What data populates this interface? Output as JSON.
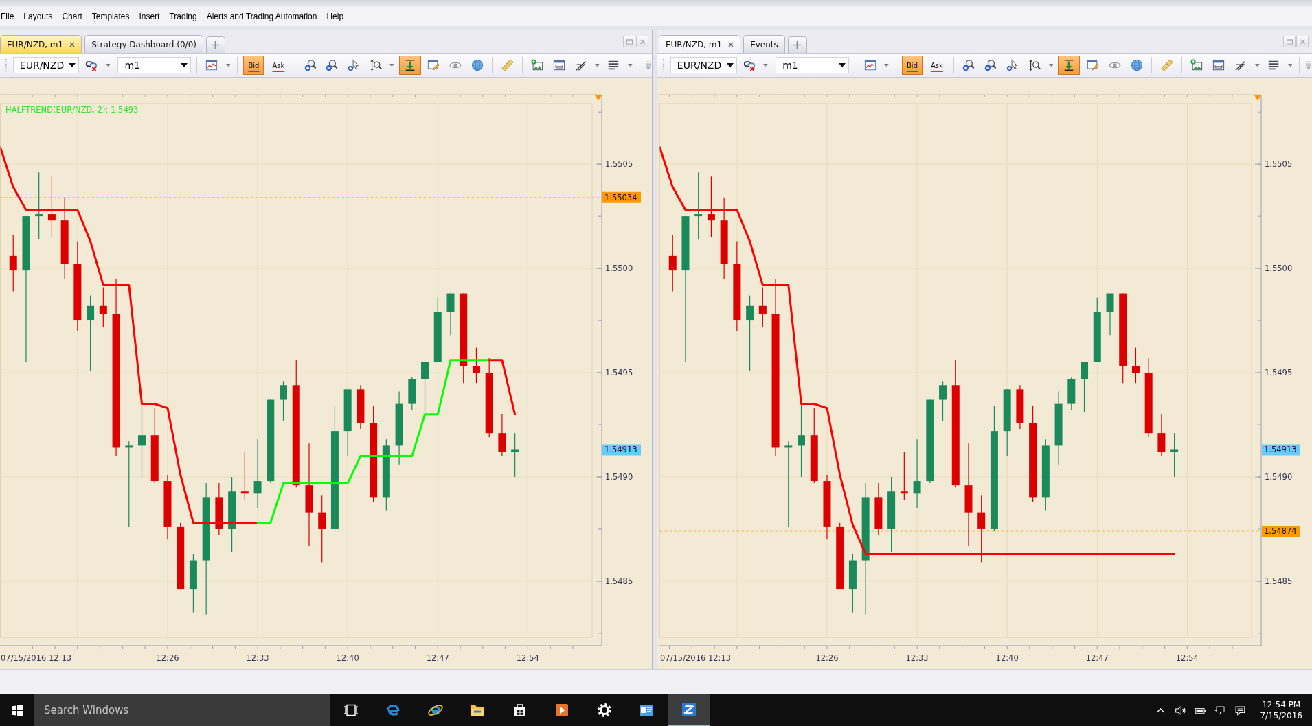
{
  "menu": [
    "File",
    "Layouts",
    "Chart",
    "Templates",
    "Insert",
    "Trading",
    "Alerts and Trading Automation",
    "Help"
  ],
  "panels": [
    {
      "active": true,
      "tabs": [
        {
          "label": "EUR/NZD, m1",
          "selected": true
        },
        {
          "label": "Strategy Dashboard (0/0)",
          "selected": false
        }
      ],
      "toolbar": {
        "symbol": "EUR/NZD",
        "timeframe": "m1",
        "price_modes": [
          {
            "label": "Bid",
            "selected": true
          },
          {
            "label": "Ask",
            "selected": false
          }
        ],
        "scroll_toggle": {
          "selected": true
        }
      },
      "chart_data": {
        "type": "candlestick",
        "x": [
          "2016-07-15T12:14",
          "2016-07-15T12:15",
          "2016-07-15T12:16",
          "2016-07-15T12:17",
          "2016-07-15T12:18",
          "2016-07-15T12:19",
          "2016-07-15T12:20",
          "2016-07-15T12:21",
          "2016-07-15T12:22",
          "2016-07-15T12:23",
          "2016-07-15T12:24",
          "2016-07-15T12:25",
          "2016-07-15T12:26",
          "2016-07-15T12:27",
          "2016-07-15T12:28",
          "2016-07-15T12:29",
          "2016-07-15T12:30",
          "2016-07-15T12:31",
          "2016-07-15T12:32",
          "2016-07-15T12:33",
          "2016-07-15T12:34",
          "2016-07-15T12:35",
          "2016-07-15T12:36",
          "2016-07-15T12:37",
          "2016-07-15T12:38",
          "2016-07-15T12:39",
          "2016-07-15T12:40",
          "2016-07-15T12:41",
          "2016-07-15T12:42",
          "2016-07-15T12:43",
          "2016-07-15T12:44",
          "2016-07-15T12:45",
          "2016-07-15T12:46",
          "2016-07-15T12:47",
          "2016-07-15T12:48",
          "2016-07-15T12:49",
          "2016-07-15T12:50",
          "2016-07-15T12:51",
          "2016-07-15T12:52",
          "2016-07-15T12:53"
        ],
        "ohlc": [
          [
            1.55006,
            1.55016,
            1.54989,
            1.54999
          ],
          [
            1.54999,
            1.55025,
            1.54955,
            1.55025
          ],
          [
            1.55025,
            1.55046,
            1.55014,
            1.55026
          ],
          [
            1.55026,
            1.55044,
            1.55015,
            1.55023
          ],
          [
            1.55023,
            1.55034,
            1.54995,
            1.55002
          ],
          [
            1.55002,
            1.55013,
            1.5497,
            1.54975
          ],
          [
            1.54975,
            1.54987,
            1.54951,
            1.54982
          ],
          [
            1.54982,
            1.54991,
            1.54972,
            1.54978
          ],
          [
            1.54978,
            1.54995,
            1.5491,
            1.54914
          ],
          [
            1.54914,
            1.54917,
            1.54876,
            1.54915
          ],
          [
            1.54915,
            1.54935,
            1.549,
            1.5492
          ],
          [
            1.5492,
            1.54933,
            1.54897,
            1.54898
          ],
          [
            1.54898,
            1.54901,
            1.5487,
            1.54876
          ],
          [
            1.54876,
            1.54878,
            1.54846,
            1.54846
          ],
          [
            1.54846,
            1.54863,
            1.54835,
            1.5486
          ],
          [
            1.5486,
            1.54897,
            1.54834,
            1.5489
          ],
          [
            1.5489,
            1.54897,
            1.54872,
            1.54875
          ],
          [
            1.54875,
            1.549,
            1.54864,
            1.54893
          ],
          [
            1.54893,
            1.54912,
            1.54889,
            1.54892
          ],
          [
            1.54892,
            1.54918,
            1.54885,
            1.54898
          ],
          [
            1.54898,
            1.54937,
            1.54897,
            1.54937
          ],
          [
            1.54937,
            1.54946,
            1.54927,
            1.54944
          ],
          [
            1.54944,
            1.54956,
            1.54895,
            1.54896
          ],
          [
            1.54896,
            1.54916,
            1.54867,
            1.54883
          ],
          [
            1.54883,
            1.54891,
            1.54859,
            1.54875
          ],
          [
            1.54875,
            1.54934,
            1.54874,
            1.54922
          ],
          [
            1.54922,
            1.54942,
            1.5491,
            1.54942
          ],
          [
            1.54942,
            1.54944,
            1.54923,
            1.54926
          ],
          [
            1.54926,
            1.54934,
            1.54888,
            1.5489
          ],
          [
            1.5489,
            1.54918,
            1.54884,
            1.54915
          ],
          [
            1.54915,
            1.54941,
            1.54906,
            1.54935
          ],
          [
            1.54935,
            1.54948,
            1.54932,
            1.54947
          ],
          [
            1.54947,
            1.54955,
            1.54931,
            1.54955
          ],
          [
            1.54955,
            1.54986,
            1.54955,
            1.54979
          ],
          [
            1.54979,
            1.54988,
            1.54968,
            1.54988
          ],
          [
            1.54988,
            1.54988,
            1.54945,
            1.54953
          ],
          [
            1.54953,
            1.54962,
            1.54945,
            1.5495
          ],
          [
            1.5495,
            1.54957,
            1.54919,
            1.54921
          ],
          [
            1.54921,
            1.5493,
            1.5491,
            1.54912
          ],
          [
            1.54912,
            1.54921,
            1.549,
            1.54913
          ]
        ],
        "series": [
          {
            "type": "line",
            "color": "#ff0000",
            "x": [
              "2016-07-15T12:13",
              "2016-07-15T12:14",
              "2016-07-15T12:15",
              "2016-07-15T12:16",
              "2016-07-15T12:17",
              "2016-07-15T12:18",
              "2016-07-15T12:19",
              "2016-07-15T12:20",
              "2016-07-15T12:21",
              "2016-07-15T12:22",
              "2016-07-15T12:23",
              "2016-07-15T12:24",
              "2016-07-15T12:25",
              "2016-07-15T12:26",
              "2016-07-15T12:27",
              "2016-07-15T12:28",
              "2016-07-15T12:29",
              "2016-07-15T12:30",
              "2016-07-15T12:31",
              "2016-07-15T12:32",
              "2016-07-15T12:33"
            ],
            "values": [
              1.55058,
              1.55039,
              1.55028,
              1.55028,
              1.55028,
              1.55028,
              1.55028,
              1.55013,
              1.54992,
              1.54992,
              1.54992,
              1.54935,
              1.54935,
              1.54933,
              1.54901,
              1.54878,
              1.54878,
              1.54878,
              1.54878,
              1.54878,
              1.54878
            ]
          },
          {
            "type": "line",
            "color": "#00ff00",
            "x": [
              "2016-07-15T12:33",
              "2016-07-15T12:34",
              "2016-07-15T12:35",
              "2016-07-15T12:36",
              "2016-07-15T12:37",
              "2016-07-15T12:38",
              "2016-07-15T12:39",
              "2016-07-15T12:40",
              "2016-07-15T12:41",
              "2016-07-15T12:42",
              "2016-07-15T12:43",
              "2016-07-15T12:44",
              "2016-07-15T12:45",
              "2016-07-15T12:46",
              "2016-07-15T12:47",
              "2016-07-15T12:48",
              "2016-07-15T12:49",
              "2016-07-15T12:50",
              "2016-07-15T12:51"
            ],
            "values": [
              1.54878,
              1.54878,
              1.54897,
              1.54897,
              1.54897,
              1.54897,
              1.54897,
              1.54897,
              1.5491,
              1.5491,
              1.5491,
              1.5491,
              1.5491,
              1.5493,
              1.5493,
              1.54956,
              1.54956,
              1.54956,
              1.54956
            ]
          },
          {
            "type": "line",
            "color": "#ff0000",
            "x": [
              "2016-07-15T12:51",
              "2016-07-15T12:52",
              "2016-07-15T12:53"
            ],
            "values": [
              1.54956,
              1.54956,
              1.5493
            ]
          }
        ],
        "xlim": [
          "2016-07-15T12:13",
          "2016-07-15T12:59"
        ],
        "ylim": [
          1.54823,
          1.55079
        ],
        "xticks": [
          {
            "value": "2016-07-15T12:13",
            "label": "07/15/2016 12:13"
          },
          {
            "value": "2016-07-15T12:26",
            "label": "12:26"
          },
          {
            "value": "2016-07-15T12:33",
            "label": "12:33"
          },
          {
            "value": "2016-07-15T12:40",
            "label": "12:40"
          },
          {
            "value": "2016-07-15T12:47",
            "label": "12:47"
          },
          {
            "value": "2016-07-15T12:54",
            "label": "12:54"
          }
        ],
        "yticks": [
          {
            "value": 1.5485,
            "label": "1.5485"
          },
          {
            "value": 1.549,
            "label": "1.5490"
          },
          {
            "value": 1.5495,
            "label": "1.5495"
          },
          {
            "value": 1.55,
            "label": "1.5500"
          },
          {
            "value": 1.5505,
            "label": "1.5505"
          }
        ],
        "ref_lines": [
          {
            "axis": "y",
            "value": 1.55034,
            "label": "1.55034",
            "color": "#ff9900",
            "line_style": "dashed"
          }
        ],
        "annotations": [
          "HALFTREND(EUR/NZD, 2): 1.5493",
          "1.54913"
        ],
        "grid": true
      }
    },
    {
      "active": false,
      "tabs": [
        {
          "label": "EUR/NZD, m1",
          "selected": true
        },
        {
          "label": "Events",
          "selected": false
        }
      ],
      "toolbar": {
        "symbol": "EUR/NZD",
        "timeframe": "m1",
        "price_modes": [
          {
            "label": "Bid",
            "selected": true
          },
          {
            "label": "Ask",
            "selected": false
          }
        ],
        "scroll_toggle": {
          "selected": true
        }
      },
      "chart_data": {
        "type": "candlestick",
        "x": [
          "2016-07-15T12:14",
          "2016-07-15T12:15",
          "2016-07-15T12:16",
          "2016-07-15T12:17",
          "2016-07-15T12:18",
          "2016-07-15T12:19",
          "2016-07-15T12:20",
          "2016-07-15T12:21",
          "2016-07-15T12:22",
          "2016-07-15T12:23",
          "2016-07-15T12:24",
          "2016-07-15T12:25",
          "2016-07-15T12:26",
          "2016-07-15T12:27",
          "2016-07-15T12:28",
          "2016-07-15T12:29",
          "2016-07-15T12:30",
          "2016-07-15T12:31",
          "2016-07-15T12:32",
          "2016-07-15T12:33",
          "2016-07-15T12:34",
          "2016-07-15T12:35",
          "2016-07-15T12:36",
          "2016-07-15T12:37",
          "2016-07-15T12:38",
          "2016-07-15T12:39",
          "2016-07-15T12:40",
          "2016-07-15T12:41",
          "2016-07-15T12:42",
          "2016-07-15T12:43",
          "2016-07-15T12:44",
          "2016-07-15T12:45",
          "2016-07-15T12:46",
          "2016-07-15T12:47",
          "2016-07-15T12:48",
          "2016-07-15T12:49",
          "2016-07-15T12:50",
          "2016-07-15T12:51",
          "2016-07-15T12:52",
          "2016-07-15T12:53"
        ],
        "ohlc": [
          [
            1.55006,
            1.55016,
            1.54989,
            1.54999
          ],
          [
            1.54999,
            1.55025,
            1.54955,
            1.55025
          ],
          [
            1.55025,
            1.55046,
            1.55014,
            1.55026
          ],
          [
            1.55026,
            1.55044,
            1.55015,
            1.55023
          ],
          [
            1.55023,
            1.55034,
            1.54995,
            1.55002
          ],
          [
            1.55002,
            1.55013,
            1.5497,
            1.54975
          ],
          [
            1.54975,
            1.54987,
            1.54951,
            1.54982
          ],
          [
            1.54982,
            1.54991,
            1.54972,
            1.54978
          ],
          [
            1.54978,
            1.54995,
            1.5491,
            1.54914
          ],
          [
            1.54914,
            1.54917,
            1.54876,
            1.54915
          ],
          [
            1.54915,
            1.54935,
            1.549,
            1.5492
          ],
          [
            1.5492,
            1.54933,
            1.54897,
            1.54898
          ],
          [
            1.54898,
            1.54901,
            1.5487,
            1.54876
          ],
          [
            1.54876,
            1.54878,
            1.54846,
            1.54846
          ],
          [
            1.54846,
            1.54863,
            1.54835,
            1.5486
          ],
          [
            1.5486,
            1.54897,
            1.54834,
            1.5489
          ],
          [
            1.5489,
            1.54897,
            1.54872,
            1.54875
          ],
          [
            1.54875,
            1.549,
            1.54864,
            1.54893
          ],
          [
            1.54893,
            1.54912,
            1.54889,
            1.54892
          ],
          [
            1.54892,
            1.54918,
            1.54885,
            1.54898
          ],
          [
            1.54898,
            1.54937,
            1.54897,
            1.54937
          ],
          [
            1.54937,
            1.54946,
            1.54927,
            1.54944
          ],
          [
            1.54944,
            1.54956,
            1.54895,
            1.54896
          ],
          [
            1.54896,
            1.54916,
            1.54867,
            1.54883
          ],
          [
            1.54883,
            1.54891,
            1.54859,
            1.54875
          ],
          [
            1.54875,
            1.54934,
            1.54874,
            1.54922
          ],
          [
            1.54922,
            1.54942,
            1.5491,
            1.54942
          ],
          [
            1.54942,
            1.54944,
            1.54923,
            1.54926
          ],
          [
            1.54926,
            1.54934,
            1.54888,
            1.5489
          ],
          [
            1.5489,
            1.54918,
            1.54884,
            1.54915
          ],
          [
            1.54915,
            1.54941,
            1.54906,
            1.54935
          ],
          [
            1.54935,
            1.54948,
            1.54932,
            1.54947
          ],
          [
            1.54947,
            1.54955,
            1.54931,
            1.54955
          ],
          [
            1.54955,
            1.54986,
            1.54955,
            1.54979
          ],
          [
            1.54979,
            1.54988,
            1.54968,
            1.54988
          ],
          [
            1.54988,
            1.54988,
            1.54945,
            1.54953
          ],
          [
            1.54953,
            1.54962,
            1.54945,
            1.5495
          ],
          [
            1.5495,
            1.54957,
            1.54919,
            1.54921
          ],
          [
            1.54921,
            1.5493,
            1.5491,
            1.54912
          ],
          [
            1.54912,
            1.54921,
            1.549,
            1.54913
          ]
        ],
        "series": [
          {
            "type": "line",
            "color": "#ff0000",
            "x": [
              "2016-07-15T12:13",
              "2016-07-15T12:14",
              "2016-07-15T12:15",
              "2016-07-15T12:16",
              "2016-07-15T12:17",
              "2016-07-15T12:18",
              "2016-07-15T12:19",
              "2016-07-15T12:20",
              "2016-07-15T12:21",
              "2016-07-15T12:22",
              "2016-07-15T12:23",
              "2016-07-15T12:24",
              "2016-07-15T12:25",
              "2016-07-15T12:26",
              "2016-07-15T12:27",
              "2016-07-15T12:28",
              "2016-07-15T12:29",
              "2016-07-15T12:30",
              "2016-07-15T12:31",
              "2016-07-15T12:32",
              "2016-07-15T12:33",
              "2016-07-15T12:34",
              "2016-07-15T12:35",
              "2016-07-15T12:36",
              "2016-07-15T12:37",
              "2016-07-15T12:38",
              "2016-07-15T12:39",
              "2016-07-15T12:40",
              "2016-07-15T12:41",
              "2016-07-15T12:42",
              "2016-07-15T12:43",
              "2016-07-15T12:44",
              "2016-07-15T12:45",
              "2016-07-15T12:46",
              "2016-07-15T12:47",
              "2016-07-15T12:48",
              "2016-07-15T12:49",
              "2016-07-15T12:50",
              "2016-07-15T12:51",
              "2016-07-15T12:52",
              "2016-07-15T12:53"
            ],
            "values": [
              1.55058,
              1.55039,
              1.55028,
              1.55028,
              1.55028,
              1.55028,
              1.55028,
              1.55013,
              1.54992,
              1.54992,
              1.54992,
              1.54935,
              1.54935,
              1.54933,
              1.54901,
              1.54877,
              1.54863,
              1.54863,
              1.54863,
              1.54863,
              1.54863,
              1.54863,
              1.54863,
              1.54863,
              1.54863,
              1.54863,
              1.54863,
              1.54863,
              1.54863,
              1.54863,
              1.54863,
              1.54863,
              1.54863,
              1.54863,
              1.54863,
              1.54863,
              1.54863,
              1.54863,
              1.54863,
              1.54863,
              1.54863
            ]
          }
        ],
        "xlim": [
          "2016-07-15T12:13",
          "2016-07-15T12:59"
        ],
        "ylim": [
          1.54823,
          1.55079
        ],
        "xticks": [
          {
            "value": "2016-07-15T12:13",
            "label": "07/15/2016 12:13"
          },
          {
            "value": "2016-07-15T12:26",
            "label": "12:26"
          },
          {
            "value": "2016-07-15T12:33",
            "label": "12:33"
          },
          {
            "value": "2016-07-15T12:40",
            "label": "12:40"
          },
          {
            "value": "2016-07-15T12:47",
            "label": "12:47"
          },
          {
            "value": "2016-07-15T12:54",
            "label": "12:54"
          }
        ],
        "yticks": [
          {
            "value": 1.5485,
            "label": "1.5485"
          },
          {
            "value": 1.549,
            "label": "1.5490"
          },
          {
            "value": 1.5495,
            "label": "1.5495"
          },
          {
            "value": 1.55,
            "label": "1.5500"
          },
          {
            "value": 1.5505,
            "label": "1.5505"
          }
        ],
        "ref_lines": [
          {
            "axis": "y",
            "value": 1.54874,
            "label": "1.54874",
            "color": "#ff9900",
            "line_style": "dashed"
          }
        ],
        "annotations": [
          "1.54913"
        ],
        "grid": true
      }
    }
  ],
  "taskbar": {
    "search": {
      "placeholder": "Search Windows"
    },
    "apps": [
      {
        "kind": "taskview",
        "selected": false
      },
      {
        "kind": "swirl",
        "selected": false
      },
      {
        "kind": "ring",
        "selected": false
      },
      {
        "kind": "folder",
        "selected": false
      },
      {
        "kind": "bag",
        "selected": false
      },
      {
        "kind": "play",
        "selected": false
      },
      {
        "kind": "gear",
        "selected": false
      },
      {
        "kind": "card",
        "selected": false
      },
      {
        "kind": "zigzag",
        "selected": true
      }
    ],
    "time": "12:54 PM",
    "date": "7/15/2016"
  }
}
